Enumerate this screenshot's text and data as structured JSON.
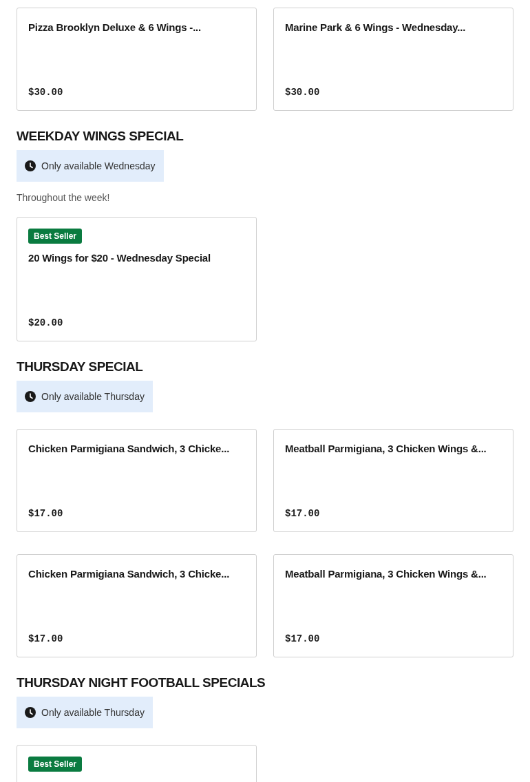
{
  "sections": [
    {
      "items": [
        {
          "title": "Pizza Brooklyn Deluxe & 6 Wings -...",
          "price": "$30.00"
        },
        {
          "title": "Marine Park & 6 Wings - Wednesday...",
          "price": "$30.00"
        }
      ]
    },
    {
      "title": "WEEKDAY WINGS SPECIAL",
      "availability": "Only available Wednesday",
      "description": "Throughout the week!",
      "items": [
        {
          "badge": "Best Seller",
          "title": "20 Wings for $20 - Wednesday Special",
          "price": "$20.00"
        }
      ]
    },
    {
      "title": "THURSDAY SPECIAL",
      "availability": "Only available Thursday",
      "items": [
        {
          "title": "Chicken Parmigiana Sandwich, 3 Chicke...",
          "price": "$17.00"
        },
        {
          "title": "Meatball Parmigiana, 3 Chicken Wings &...",
          "price": "$17.00"
        },
        {
          "title": "Chicken Parmigiana Sandwich, 3 Chicke...",
          "price": "$17.00"
        },
        {
          "title": "Meatball Parmigiana, 3 Chicken Wings &...",
          "price": "$17.00"
        }
      ]
    },
    {
      "title": "THURSDAY NIGHT FOOTBALL SPECIALS",
      "availability": "Only available Thursday",
      "items": [
        {
          "badge": "Best Seller"
        }
      ]
    }
  ]
}
